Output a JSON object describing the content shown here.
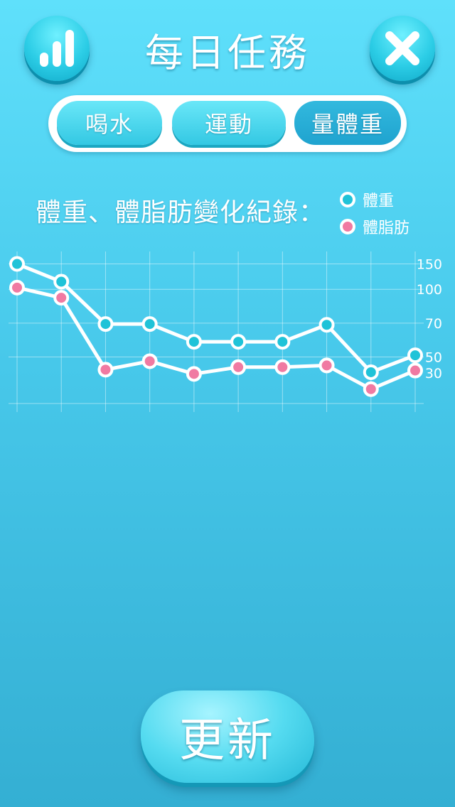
{
  "header": {
    "title": "每日任務",
    "stats_icon": "bar-chart-icon",
    "close_icon": "close-icon"
  },
  "tabs": [
    {
      "label": "喝水",
      "selected": false
    },
    {
      "label": "運動",
      "selected": false
    },
    {
      "label": "量體重",
      "selected": true
    }
  ],
  "chart_section": {
    "title": "體重、體脂肪變化紀錄："
  },
  "colors": {
    "weight": "#1fc3d8",
    "body_fat": "#f07aa2"
  },
  "chart_data": {
    "type": "line",
    "x": [
      1,
      2,
      3,
      4,
      5,
      6,
      7,
      8,
      9,
      10
    ],
    "series": [
      {
        "name": "體重",
        "values": [
          150,
          129,
          79,
          79,
          58,
          58,
          58,
          78,
          22,
          42
        ]
      },
      {
        "name": "體脂肪",
        "values": [
          122,
          110,
          25,
          35,
          20,
          28,
          28,
          30,
          2,
          24
        ]
      }
    ],
    "y_tick_labels": [
      "150",
      "100",
      "70",
      "50",
      "30"
    ],
    "y_tick_values": [
      150,
      120,
      80,
      40,
      21
    ],
    "ylim": [
      -15,
      158
    ],
    "grid": true,
    "legend": "top-right"
  },
  "update_button": {
    "label": "更新"
  }
}
